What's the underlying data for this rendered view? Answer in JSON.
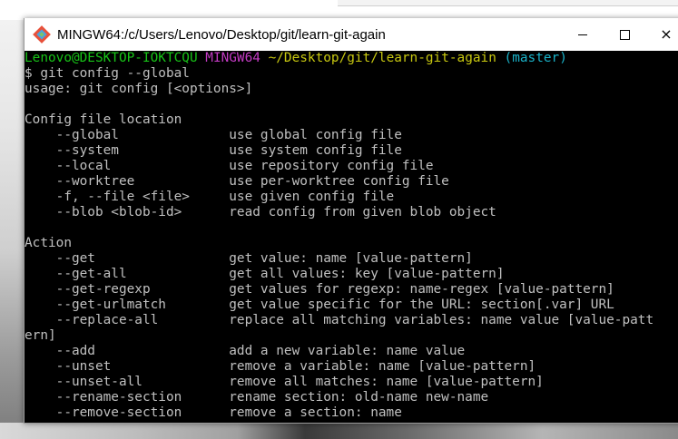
{
  "window": {
    "title": "MINGW64:/c/Users/Lenovo/Desktop/git/learn-git-again",
    "controls": {
      "minimize": "minimize",
      "maximize": "maximize",
      "close": "×"
    }
  },
  "prompt": {
    "user_host": "Lenovo@DESKTOP-IOKTCQU",
    "shell": "MINGW64",
    "path": "~/Desktop/git/learn-git-again",
    "branch": "(master)"
  },
  "command": "$ git config --global",
  "output": [
    "usage: git config [<options>]",
    "",
    "Config file location",
    "    --global              use global config file",
    "    --system              use system config file",
    "    --local               use repository config file",
    "    --worktree            use per-worktree config file",
    "    -f, --file <file>     use given config file",
    "    --blob <blob-id>      read config from given blob object",
    "",
    "Action",
    "    --get                 get value: name [value-pattern]",
    "    --get-all             get all values: key [value-pattern]",
    "    --get-regexp          get values for regexp: name-regex [value-pattern]",
    "    --get-urlmatch        get value specific for the URL: section[.var] URL",
    "    --replace-all         replace all matching variables: name value [value-patt",
    "ern]",
    "    --add                 add a new variable: name value",
    "    --unset               remove a variable: name [value-pattern]",
    "    --unset-all           remove all matches: name [value-pattern]",
    "    --rename-section      rename section: old-name new-name",
    "    --remove-section      remove a section: name"
  ]
}
